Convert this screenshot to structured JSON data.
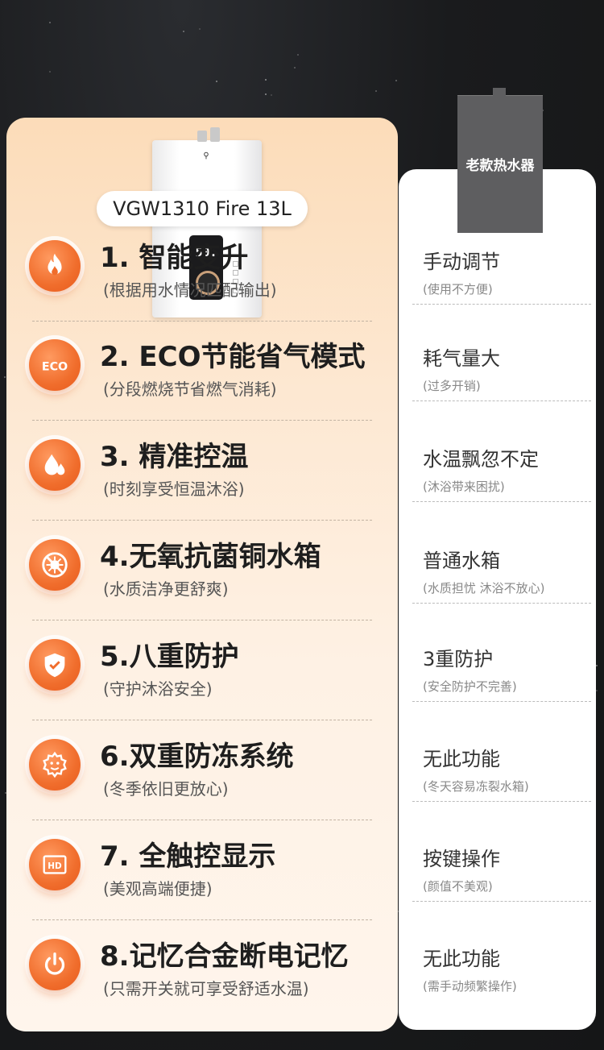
{
  "product": {
    "model": "VGW1310 Fire 13L",
    "display_temp": "50."
  },
  "old_heater": {
    "label": "老款热水器"
  },
  "features": [
    {
      "title": "1. 智能变升",
      "sub": "(根据用水情况匹配输出)",
      "icon": "flame-icon"
    },
    {
      "title": "2. ECO节能省气模式",
      "sub": "(分段燃烧节省燃气消耗)",
      "icon": "eco-icon"
    },
    {
      "title": "3. 精准控温",
      "sub": "(时刻享受恒温沐浴)",
      "icon": "water-drop-icon"
    },
    {
      "title": "4.无氧抗菌铜水箱",
      "sub": "(水质洁净更舒爽)",
      "icon": "no-bacteria-icon"
    },
    {
      "title": "5.八重防护",
      "sub": "(守护沐浴安全)",
      "icon": "shield-check-icon"
    },
    {
      "title": "6.双重防冻系统",
      "sub": "(冬季依旧更放心)",
      "icon": "antifreeze-gear-icon"
    },
    {
      "title": "7. 全触控显示",
      "sub": "(美观高端便捷)",
      "icon": "hd-display-icon"
    },
    {
      "title": "8.记忆合金断电记忆",
      "sub": "(只需开关就可享受舒适水温)",
      "icon": "power-icon"
    }
  ],
  "old_features": [
    {
      "title": "手动调节",
      "sub": "(使用不方便)"
    },
    {
      "title": "耗气量大",
      "sub": "(过多开销)"
    },
    {
      "title": "水温飘忽不定",
      "sub": "(沐浴带来困扰)"
    },
    {
      "title": "普通水箱",
      "sub": "(水质担忧 沐浴不放心)"
    },
    {
      "title": "3重防护",
      "sub": "(安全防护不完善)"
    },
    {
      "title": "无此功能",
      "sub": "(冬天容易冻裂水箱)"
    },
    {
      "title": "按键操作",
      "sub": "(颜值不美观)"
    },
    {
      "title": "无此功能",
      "sub": "(需手动频繁操作)"
    }
  ],
  "colors": {
    "accent": "#f06d2c",
    "card_top": "#fcdcb9",
    "old_heater": "#5e5e60"
  }
}
